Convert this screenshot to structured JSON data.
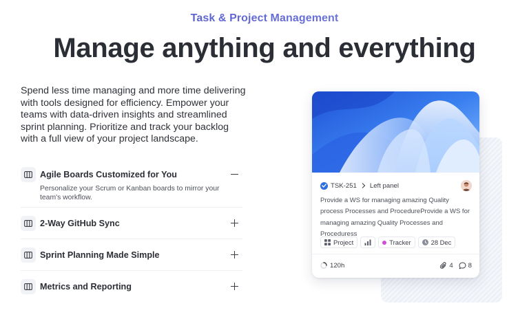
{
  "eyebrow": "Task & Project Management",
  "headline": "Manage anything and everything",
  "intro": "Spend less time managing and more time delivering with tools designed for efficiency. Empower your teams with data-driven insights and streamlined sprint planning. Prioritize and track your backlog with a full view of your project landscape.",
  "features": [
    {
      "title": "Agile Boards Customized for You",
      "body": "Personalize your Scrum or Kanban boards to mirror your team's workflow.",
      "expanded": true,
      "icon": "board-icon"
    },
    {
      "title": "2-Way GitHub Sync",
      "body": "",
      "expanded": false,
      "icon": "board-icon"
    },
    {
      "title": "Sprint Planning Made Simple",
      "body": "",
      "expanded": false,
      "icon": "board-icon"
    },
    {
      "title": "Metrics and Reporting",
      "body": "",
      "expanded": false,
      "icon": "board-icon"
    }
  ],
  "task_card": {
    "task_id": "TSK-251",
    "panel": "Left panel",
    "description": "Provide a WS for managing amazing Quality process Processes and ProcedureProvide a WS for managing amazing Quality Processes and Proceduress",
    "chips": {
      "project": "Project",
      "tracker": "Tracker",
      "date": "28 Dec"
    },
    "estimate": "120h",
    "attachments": "4",
    "comments": "8",
    "colors": {
      "accent": "#2f6fdf",
      "tracker_dot": "#d24bd6"
    }
  }
}
